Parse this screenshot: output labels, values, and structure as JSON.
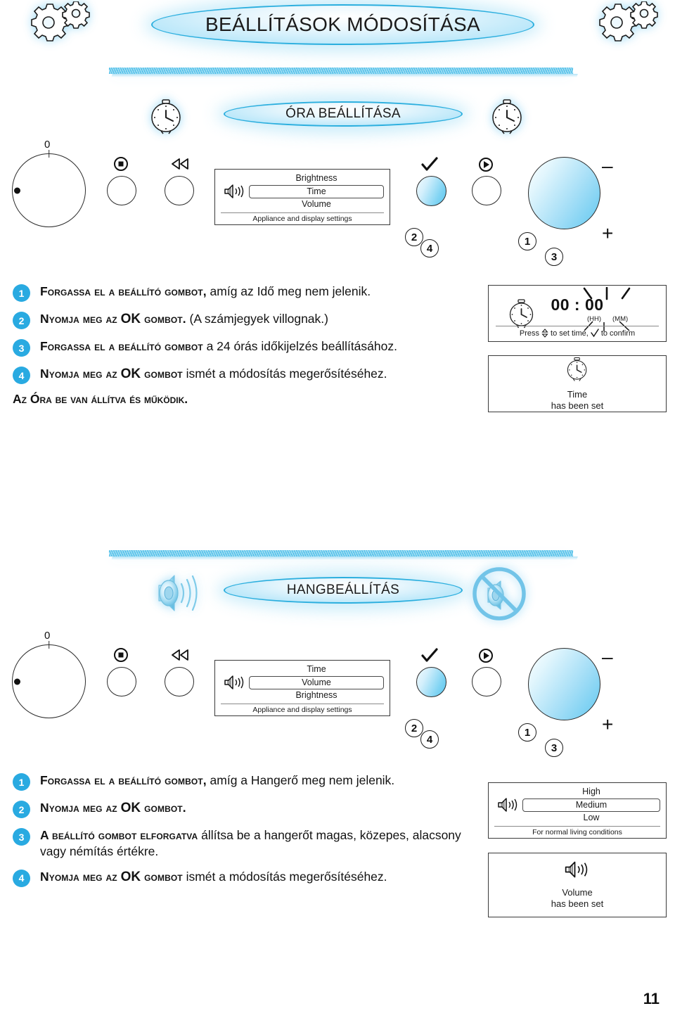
{
  "page": {
    "number": "11",
    "main_title": "BEÁLLÍTÁSOK MÓDOSÍTÁSA"
  },
  "clock_section": {
    "title": "ÓRA BEÁLLÍTÁSA",
    "knob_label": "0",
    "minus": "–",
    "plus": "+",
    "callouts": {
      "a": "2",
      "b": "4",
      "c": "1",
      "d": "3"
    },
    "menu": {
      "options": [
        "Brightness",
        "Time",
        "Volume"
      ],
      "selected": "Time",
      "footer": "Appliance and display settings"
    },
    "steps": [
      {
        "num": "1",
        "caps": "Forgassa el a beállító gombot,",
        "rest": " amíg az Idő meg nem jelenik."
      },
      {
        "num": "2",
        "caps_pre": "Nyomja meg az ",
        "ok": "OK",
        "caps_post": " gombot.",
        "rest": " (A számjegyek villognak.)"
      },
      {
        "num": "3",
        "caps": "Forgassa el a beállító gombot",
        "rest": " a 24 órás időkijelzés beállításához."
      },
      {
        "num": "4",
        "caps_pre": "Nyomja meg az ",
        "ok": "OK",
        "caps_post": " gombot",
        "rest": " ismét a módosítás megerősítéséhez."
      }
    ],
    "closing": "Az Óra be van állítva és működik.",
    "display_setting": {
      "time_value": "00 : 00",
      "hh_label": "(HH)",
      "mm_label": "(MM)",
      "hint_pre": "Press",
      "hint_mid": "to set time,",
      "hint_post": "to confirm"
    },
    "display_done": {
      "line1": "Time",
      "line2": "has been set"
    }
  },
  "sound_section": {
    "title": "HANGBEÁLLÍTÁS",
    "knob_label": "0",
    "minus": "–",
    "plus": "+",
    "callouts": {
      "a": "2",
      "b": "4",
      "c": "1",
      "d": "3"
    },
    "menu": {
      "options": [
        "Time",
        "Volume",
        "Brightness"
      ],
      "selected": "Volume",
      "footer": "Appliance and display settings"
    },
    "steps": [
      {
        "num": "1",
        "caps": "Forgassa el a beállító gombot,",
        "rest": " amíg a Hangerő meg nem jelenik."
      },
      {
        "num": "2",
        "caps_pre": "Nyomja meg az ",
        "ok": "OK",
        "caps_post": " gombot.",
        "rest": ""
      },
      {
        "num": "3",
        "caps": "A beállító gombot elforgatva",
        "rest": " állítsa be a hangerőt magas, közepes, alacsony vagy némítás értékre."
      },
      {
        "num": "4",
        "caps_pre": "Nyomja meg az ",
        "ok": "OK",
        "caps_post": " gombot",
        "rest": " ismét a módosítás megerősítéséhez."
      }
    ],
    "display_setting": {
      "options": [
        "High",
        "Medium",
        "Low"
      ],
      "selected": "Medium",
      "footer": "For normal living conditions"
    },
    "display_done": {
      "line1": "Volume",
      "line2": "has been set"
    }
  },
  "colors": {
    "accent": "#29aae1",
    "accent_dark": "#2aaede",
    "pale": "#bfe9fa",
    "ink": "#111111"
  }
}
